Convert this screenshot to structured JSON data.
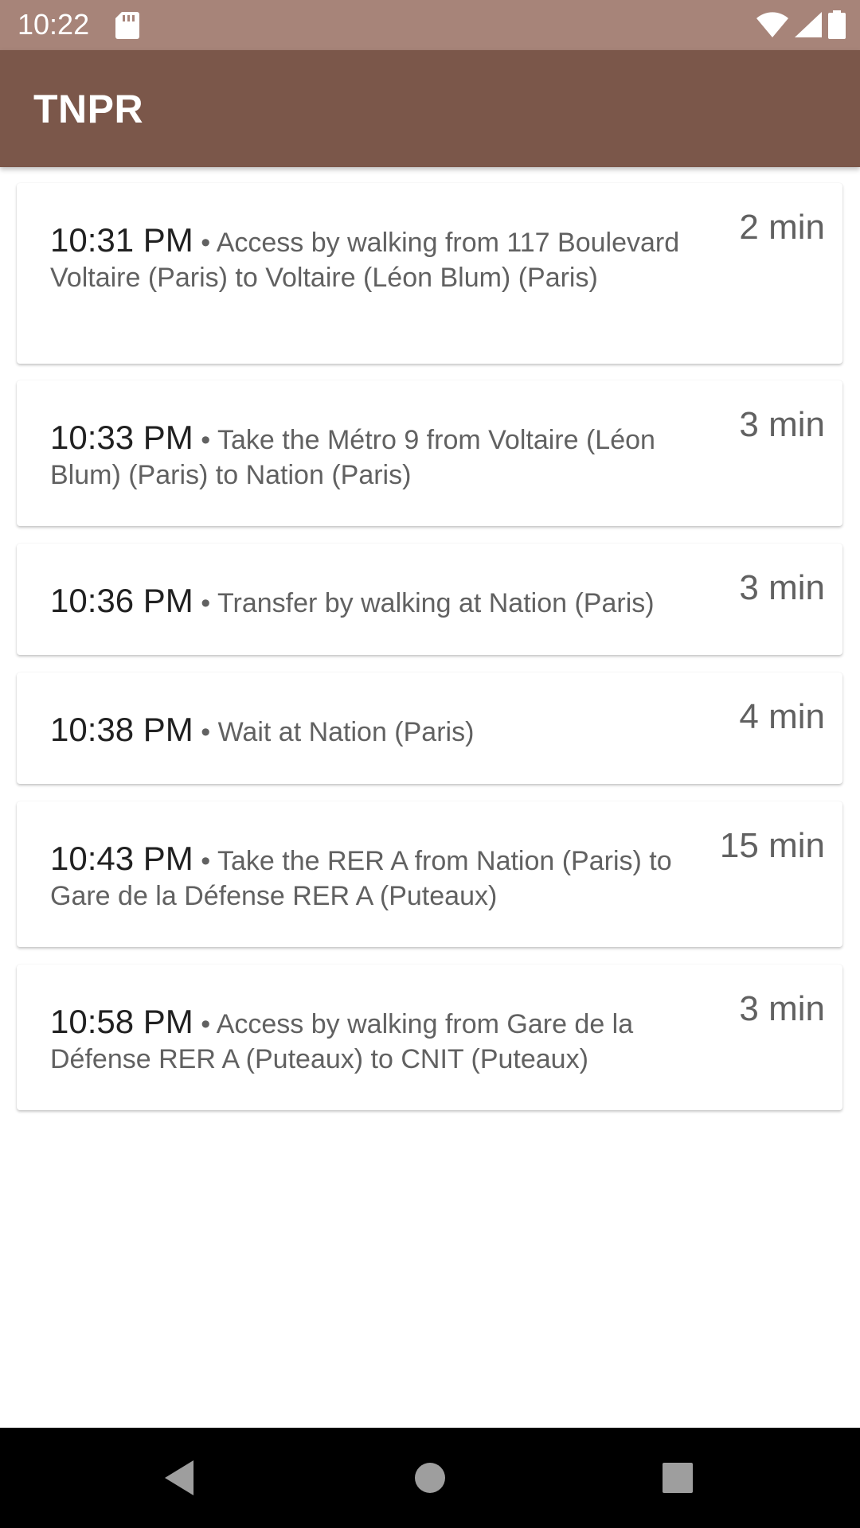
{
  "status_bar": {
    "time": "10:22",
    "icons": [
      "sd-card-icon",
      "wifi-icon",
      "signal-icon",
      "battery-icon"
    ]
  },
  "app_bar": {
    "title": "TNPR"
  },
  "steps": [
    {
      "time": "10:31 PM",
      "separator": "•",
      "description": "Access by walking from 117 Boulevard Voltaire (Paris) to Voltaire (Léon Blum) (Paris)",
      "duration": "2 min"
    },
    {
      "time": "10:33 PM",
      "separator": "•",
      "description": "Take the Métro 9 from Voltaire (Léon Blum) (Paris) to Nation (Paris)",
      "duration": "3 min"
    },
    {
      "time": "10:36 PM",
      "separator": "•",
      "description": "Transfer by walking at Nation (Paris)",
      "duration": "3 min"
    },
    {
      "time": "10:38 PM",
      "separator": "•",
      "description": "Wait at Nation (Paris)",
      "duration": "4 min"
    },
    {
      "time": "10:43 PM",
      "separator": "•",
      "description": "Take the RER A from Nation (Paris) to Gare de la Défense RER A (Puteaux)",
      "duration": "15 min"
    },
    {
      "time": "10:58 PM",
      "separator": "•",
      "description": "Access by walking from Gare de la Défense RER A (Puteaux) to CNIT (Puteaux)",
      "duration": "3 min"
    }
  ],
  "nav_bar": {
    "icons": [
      "back-icon",
      "home-icon",
      "recents-icon"
    ]
  },
  "colors": {
    "status_bar": "#a78479",
    "app_bar": "#7b574a",
    "nav_bar": "#000000"
  }
}
